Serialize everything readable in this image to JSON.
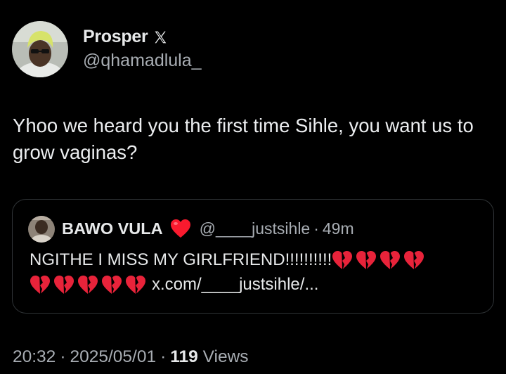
{
  "author": {
    "name": "Prosper",
    "handle": "@qhamadlula_",
    "verified_icon": "x-logo-icon"
  },
  "tweet": {
    "text": "Yhoo we heard you the first time Sihle, you want us to grow vaginas?"
  },
  "quote": {
    "name": "BAWO VULA",
    "name_emoji": "red-heart-icon",
    "handle": "@____justsihle",
    "separator": "·",
    "time": "49m",
    "text": "NGITHE I MISS MY GIRLFRIEND!!!!!!!!!!",
    "emoji_after_text": "broken-heart-icon",
    "link": "x.com/____justsihle/..."
  },
  "meta": {
    "time": "20:32",
    "separator": "·",
    "date": "2025/05/01",
    "views_count": "119",
    "views_label": "Views"
  },
  "colors": {
    "background": "#000000",
    "text": "#e7e9ea",
    "secondary": "#a8adb3",
    "border": "#2f3336",
    "heart": "#f91a2e"
  }
}
